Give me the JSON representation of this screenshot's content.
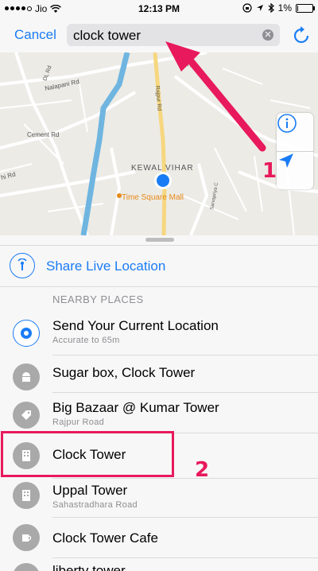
{
  "status_bar": {
    "carrier": "Jio",
    "time": "12:13 PM",
    "battery_percent": "1%",
    "battery_level": 0.05
  },
  "search": {
    "cancel_label": "Cancel",
    "query": "clock tower"
  },
  "map": {
    "area_label": "KEWAL VIHAR",
    "poi_label": "Time Square Mall",
    "road_labels": [
      "Nalapani Rd",
      "Cement Rd",
      "DL Rd",
      "hi Rd",
      "Rajpur Rd",
      "Yoga Rd",
      "Sarvapriya C"
    ]
  },
  "share": {
    "label": "Share Live Location"
  },
  "nearby": {
    "header": "NEARBY PLACES",
    "items": [
      {
        "name": "Send Your Current Location",
        "subtitle": "Accurate to 65m",
        "icon": "current-location-icon"
      },
      {
        "name": "Sugar box, Clock Tower",
        "subtitle": "",
        "icon": "food-icon"
      },
      {
        "name": "Big Bazaar @ Kumar Tower",
        "subtitle": "Rajpur Road",
        "icon": "shopping-icon"
      },
      {
        "name": "Clock Tower",
        "subtitle": "",
        "icon": "building-icon"
      },
      {
        "name": "Uppal Tower",
        "subtitle": "Sahastradhara Road",
        "icon": "building-icon"
      },
      {
        "name": "Clock Tower Cafe",
        "subtitle": "",
        "icon": "cafe-icon"
      },
      {
        "name": "liberty tower",
        "subtitle": "",
        "icon": "building-icon"
      }
    ]
  },
  "annotations": {
    "arrow_label": "1",
    "highlight_label": "2"
  },
  "colors": {
    "accent": "#1a7cf5",
    "annotation": "#e8195c"
  }
}
